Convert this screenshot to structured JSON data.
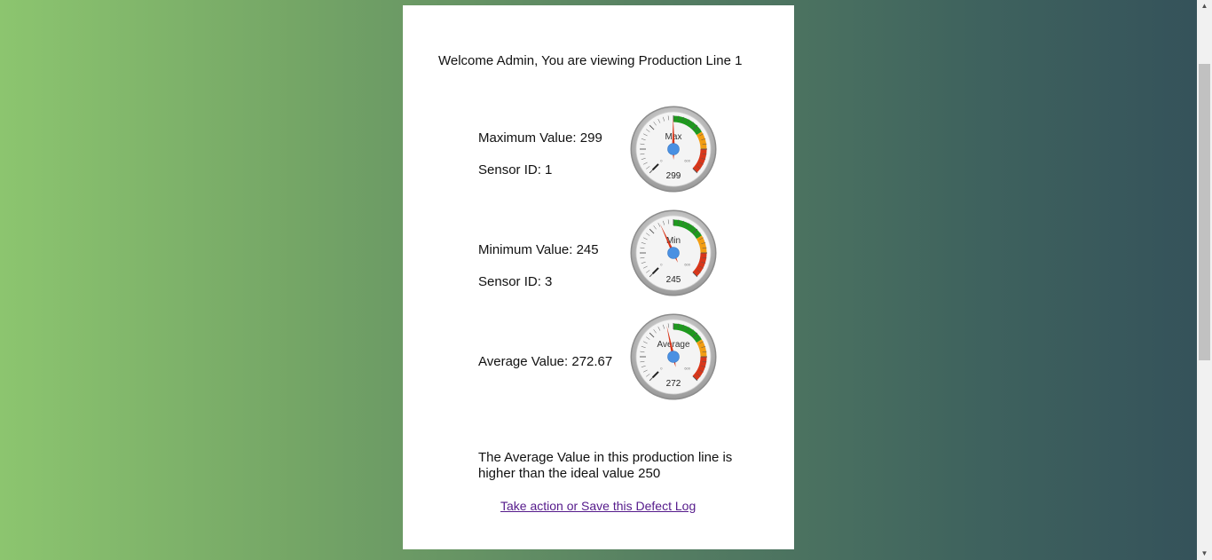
{
  "header": {
    "welcome_text": "Welcome Admin, You are viewing Production Line 1"
  },
  "readings": {
    "max": {
      "label": "Maximum Value: 299",
      "sensor": "Sensor ID: 1",
      "gauge_title": "Max",
      "gauge_value": 299,
      "gauge_display": "299"
    },
    "min": {
      "label": "Minimum Value: 245",
      "sensor": "Sensor ID: 3",
      "gauge_title": "Min",
      "gauge_value": 245,
      "gauge_display": "245"
    },
    "avg": {
      "label": "Average Value: 272.67",
      "gauge_title": "Average",
      "gauge_value": 272.67,
      "gauge_display": "272"
    }
  },
  "gauge_scale": {
    "min": 0,
    "max": 600,
    "min_label": "0",
    "max_label": "600",
    "colors": {
      "green": "#1e9a1e",
      "orange": "#f29d12",
      "red": "#d8361a",
      "needle": "#d8361a",
      "hub": "#4a90e2"
    }
  },
  "message": {
    "text": "The Average Value in this production line is higher than the ideal value 250"
  },
  "actions": {
    "defect_link": "Take action or Save this Defect Log"
  },
  "icons": {
    "scroll_up": "scroll-up-arrow-icon",
    "scroll_down": "scroll-down-arrow-icon"
  }
}
